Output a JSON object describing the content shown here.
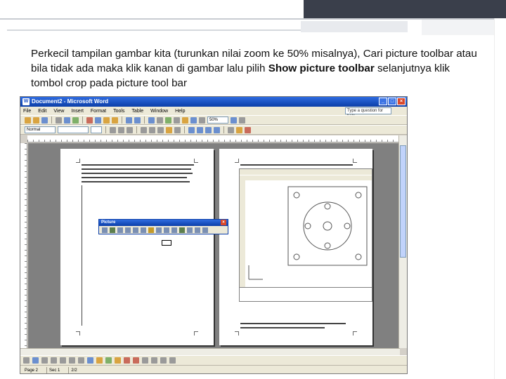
{
  "slide": {
    "text_before": "Perkecil tampilan gambar kita (turunkan nilai zoom ke 50% misalnya), Cari picture toolbar atau bila tidak ada maka klik kanan di gambar lalu pilih ",
    "text_bold": "Show picture toolbar",
    "text_after": " selanjutnya klik tombol crop pada picture tool bar"
  },
  "word": {
    "window_title": "Document2 - Microsoft Word",
    "menu": [
      "File",
      "Edit",
      "View",
      "Insert",
      "Format",
      "Tools",
      "Table",
      "Window",
      "Help"
    ],
    "help_placeholder": "Type a question for help",
    "style_value": "Normal",
    "zoom_value": "50%",
    "picture_toolbar_title": "Picture",
    "status": {
      "page": "Page 2",
      "sec": "Sec 1",
      "pages": "2/2"
    }
  }
}
